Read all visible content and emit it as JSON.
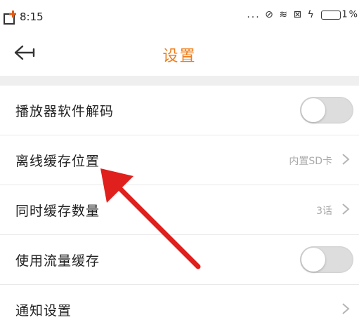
{
  "status_bar": {
    "time": "8:15",
    "icons_text": "... ⊘ ≋ ⊠ ϟ",
    "battery_text": "1%"
  },
  "nav": {
    "title": "设置",
    "back_icon": "back-arrow-icon"
  },
  "settings": {
    "items": [
      {
        "label": "播放器软件解码",
        "control": "toggle",
        "on": false
      },
      {
        "label": "离线缓存位置",
        "value": "内置SD卡",
        "control": "chevron"
      },
      {
        "label": "同时缓存数量",
        "value": "3话",
        "control": "chevron"
      },
      {
        "label": "使用流量缓存",
        "control": "toggle",
        "on": false
      },
      {
        "label": "通知设置",
        "control": "chevron"
      }
    ]
  },
  "colors": {
    "accent": "#f07d1a",
    "annotation_arrow": "#e0201c",
    "toggle_off": "#dddddd"
  }
}
